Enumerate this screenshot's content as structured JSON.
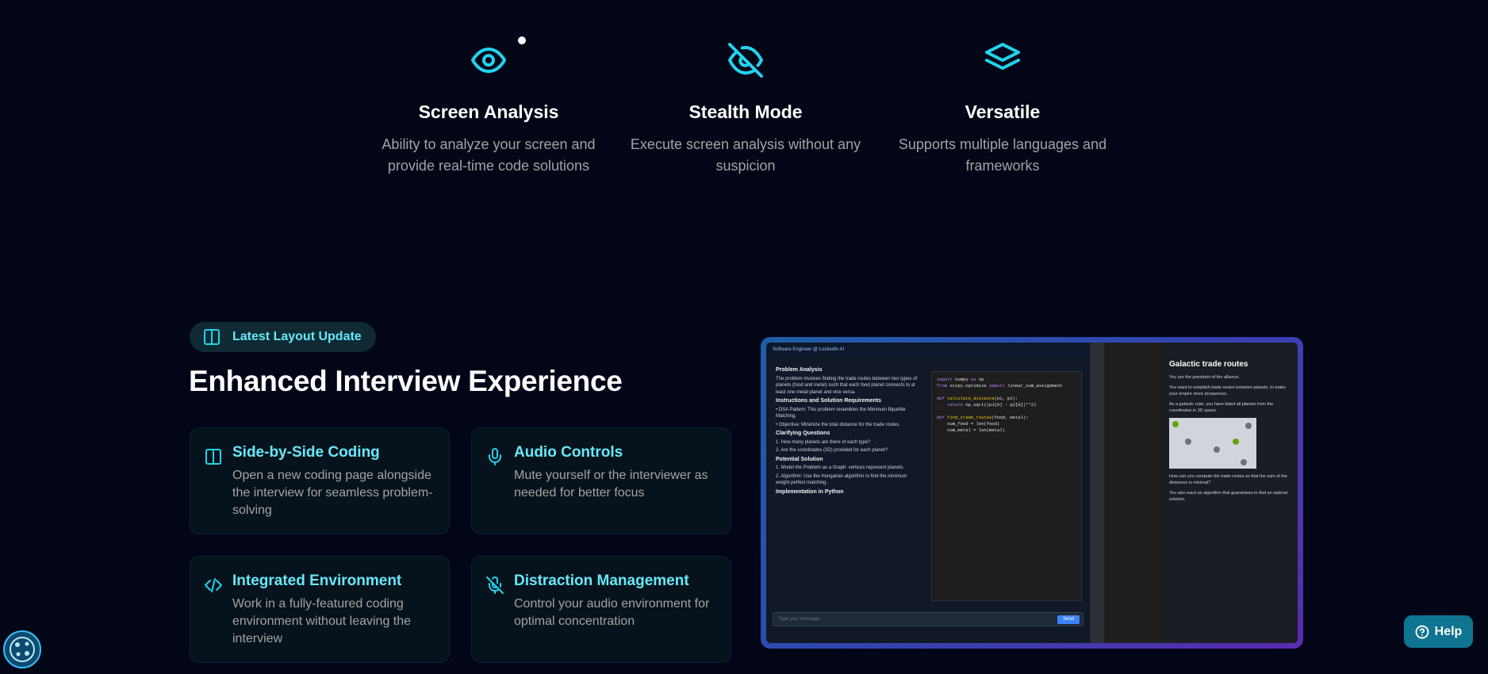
{
  "features": [
    {
      "title": "Screen Analysis",
      "description": "Ability to analyze your screen and provide real-time code solutions",
      "icon": "eye-icon"
    },
    {
      "title": "Stealth Mode",
      "description": "Execute screen analysis without any suspicion",
      "icon": "eye-off-icon"
    },
    {
      "title": "Versatile",
      "description": "Supports multiple languages and frameworks",
      "icon": "layers-icon"
    }
  ],
  "section": {
    "badge_label": "Latest Layout Update",
    "heading": "Enhanced Interview Experience"
  },
  "cards": [
    {
      "title": "Side-by-Side Coding",
      "description": "Open a new coding page alongside the interview for seamless problem-solving",
      "icon": "columns-icon"
    },
    {
      "title": "Audio Controls",
      "description": "Mute yourself or the interviewer as needed for better focus",
      "icon": "mic-icon"
    },
    {
      "title": "Integrated Environment",
      "description": "Work in a fully-featured coding environment without leaving the interview",
      "icon": "code-icon"
    },
    {
      "title": "Distraction Management",
      "description": "Control your audio environment for optimal concentration",
      "icon": "mic-off-icon"
    }
  ],
  "screenshot": {
    "app_title": "Software Engineer @ LockedIn AI",
    "chat_sections": [
      "Problem Analysis",
      "Instructions and Solution Requirements",
      "Clarifying Questions",
      "Potential Solution",
      "Implementation in Python"
    ],
    "input_placeholder": "Type your message...",
    "send_label": "Send",
    "doc_title": "Galactic trade routes"
  },
  "help_label": "Help",
  "colors": {
    "accent": "#67e8f9",
    "background": "#020617",
    "card": "#06131c",
    "help": "#0e7490"
  }
}
